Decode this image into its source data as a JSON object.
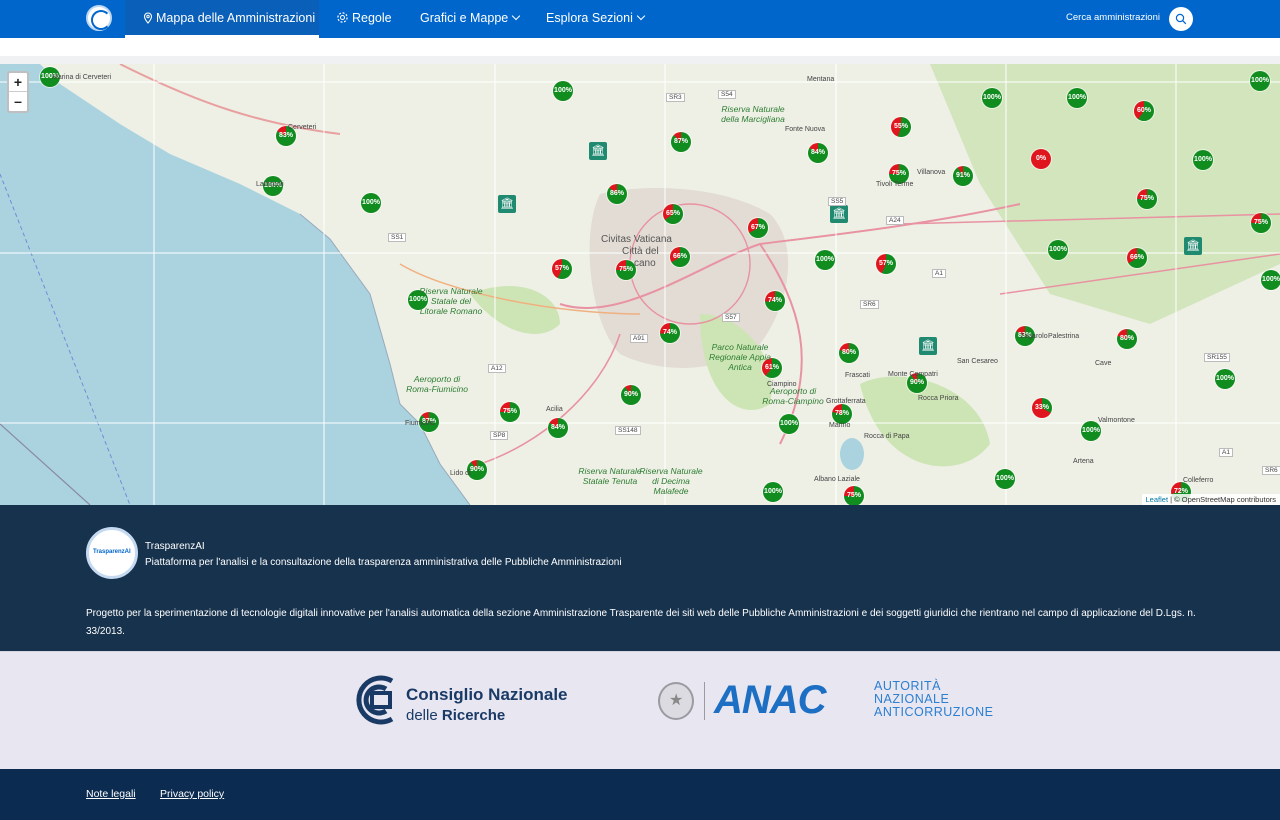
{
  "nav": {
    "items": [
      {
        "label": "Mappa delle Amministrazioni",
        "icon": "map-pin-icon",
        "active": true
      },
      {
        "label": "Regole",
        "icon": "gear-icon"
      },
      {
        "label": "Grafici e Mappe",
        "dropdown": true
      },
      {
        "label": "Esplora Sezioni",
        "dropdown": true
      }
    ],
    "search_label": "Cerca amministrazioni"
  },
  "map": {
    "zoom_in": "+",
    "zoom_out": "–",
    "attribution_leaflet": "Leaflet",
    "attribution_osm": "| © OpenStreetMap contributors",
    "places": [
      {
        "name": "Civitas Vaticana",
        "big": true
      },
      {
        "name": "Città del",
        "big": true
      },
      {
        "name": "cano",
        "big": true
      },
      {
        "name": "Mentana"
      },
      {
        "name": "Fonte Nuova"
      },
      {
        "name": "Villanova"
      },
      {
        "name": "Tivoli Terme"
      },
      {
        "name": "Ciampino"
      },
      {
        "name": "Frascati"
      },
      {
        "name": "Grottaferrata"
      },
      {
        "name": "Marino"
      },
      {
        "name": "Rocca di Papa"
      },
      {
        "name": "Rocca Priora"
      },
      {
        "name": "Albano Laziale"
      },
      {
        "name": "Acilia"
      },
      {
        "name": "Lido di"
      },
      {
        "name": "Fiumicino"
      },
      {
        "name": "Zagarolo"
      },
      {
        "name": "Palestrina"
      },
      {
        "name": "San Cesareo"
      },
      {
        "name": "Cave"
      },
      {
        "name": "Valmontone"
      },
      {
        "name": "Artena"
      },
      {
        "name": "Colleferro"
      },
      {
        "name": "Monte Compatri"
      },
      {
        "name": "Cerveteri"
      },
      {
        "name": "Ladispoli"
      },
      {
        "name": "Marina di Cerveteri"
      }
    ],
    "reserves": [
      {
        "name": "Riserva Naturale della Marcigliana"
      },
      {
        "name": "Riserva Naturale Statale del Litorale Romano"
      },
      {
        "name": "Parco Naturale Regionale Appia Antica"
      },
      {
        "name": "Riserva Naturale di Decima Malafede"
      },
      {
        "name": "Riserva Naturale Statale Tenuta"
      },
      {
        "name": "Aeroporto di Roma-Ciampino"
      },
      {
        "name": "Aeroporto di Roma-Fiumicino"
      }
    ],
    "roads": [
      "SR3",
      "S54",
      "SS1",
      "A24",
      "A1",
      "SS5",
      "SR6",
      "S57",
      "A91",
      "A12",
      "SS148",
      "SP8",
      "SR155",
      "A1",
      "SR6"
    ],
    "markers": [
      {
        "pct": "100%",
        "value": 100
      },
      {
        "pct": "100%",
        "value": 100
      },
      {
        "pct": "83%",
        "value": 83
      },
      {
        "pct": "100%",
        "value": 100
      },
      {
        "pct": "100%",
        "value": 100
      },
      {
        "pct": "87%",
        "value": 87
      },
      {
        "pct": "86%",
        "value": 86
      },
      {
        "pct": "65%",
        "value": 65
      },
      {
        "pct": "67%",
        "value": 67
      },
      {
        "pct": "84%",
        "value": 84
      },
      {
        "pct": "55%",
        "value": 55
      },
      {
        "pct": "100%",
        "value": 100
      },
      {
        "pct": "100%",
        "value": 100
      },
      {
        "pct": "60%",
        "value": 60
      },
      {
        "pct": "0%",
        "value": 0
      },
      {
        "pct": "100%",
        "value": 100
      },
      {
        "pct": "100%",
        "value": 100
      },
      {
        "pct": "91%",
        "value": 91
      },
      {
        "pct": "75%",
        "value": 75
      },
      {
        "pct": "75%",
        "value": 75
      },
      {
        "pct": "57%",
        "value": 57
      },
      {
        "pct": "75%",
        "value": 75
      },
      {
        "pct": "66%",
        "value": 66
      },
      {
        "pct": "100%",
        "value": 100
      },
      {
        "pct": "57%",
        "value": 57
      },
      {
        "pct": "100%",
        "value": 100
      },
      {
        "pct": "66%",
        "value": 66
      },
      {
        "pct": "100%",
        "value": 100
      },
      {
        "pct": "100%",
        "value": 100
      },
      {
        "pct": "74%",
        "value": 74
      },
      {
        "pct": "74%",
        "value": 74
      },
      {
        "pct": "83%",
        "value": 83
      },
      {
        "pct": "80%",
        "value": 80
      },
      {
        "pct": "80%",
        "value": 80
      },
      {
        "pct": "61%",
        "value": 61
      },
      {
        "pct": "90%",
        "value": 90
      },
      {
        "pct": "90%",
        "value": 90
      },
      {
        "pct": "100%",
        "value": 100
      },
      {
        "pct": "33%",
        "value": 33
      },
      {
        "pct": "87%",
        "value": 87
      },
      {
        "pct": "75%",
        "value": 75
      },
      {
        "pct": "84%",
        "value": 84
      },
      {
        "pct": "78%",
        "value": 78
      },
      {
        "pct": "100%",
        "value": 100
      },
      {
        "pct": "100%",
        "value": 100
      },
      {
        "pct": "90%",
        "value": 90
      },
      {
        "pct": "100%",
        "value": 100
      },
      {
        "pct": "75%",
        "value": 75
      },
      {
        "pct": "100%",
        "value": 100
      },
      {
        "pct": "72%",
        "value": 72
      },
      {
        "pct": "75%",
        "value": 75
      }
    ]
  },
  "footer": {
    "logo_text": "TrasparenzAI",
    "title": "TrasparenzAI",
    "subtitle": "Piattaforma per l'analisi e la consultazione della trasparenza amministrativa delle Pubbliche Amministrazioni",
    "description": "Progetto per la sperimentazione di tecnologie digitali innovative per l'analisi automatica della sezione Amministrazione Trasparente dei siti web delle Pubbliche Amministrazioni e dei soggetti giuridici che rientrano nel campo di applicazione del D.Lgs. n. 33/2013.",
    "cnr_line1": "Consiglio Nazionale",
    "cnr_line2a": "delle ",
    "cnr_line2b": "Ricerche",
    "anac_word": "ANAC",
    "anac_sub1": "AUTORITÀ",
    "anac_sub2": "NAZIONALE",
    "anac_sub3": "ANTICORRUZIONE",
    "links": [
      "Note legali",
      "Privacy policy"
    ]
  },
  "colors": {
    "primary": "#0066cc",
    "footer_dark": "#17324d",
    "footer_bottom": "#0b2b50",
    "marker_green": "#118c1f",
    "marker_red": "#e0161e"
  }
}
